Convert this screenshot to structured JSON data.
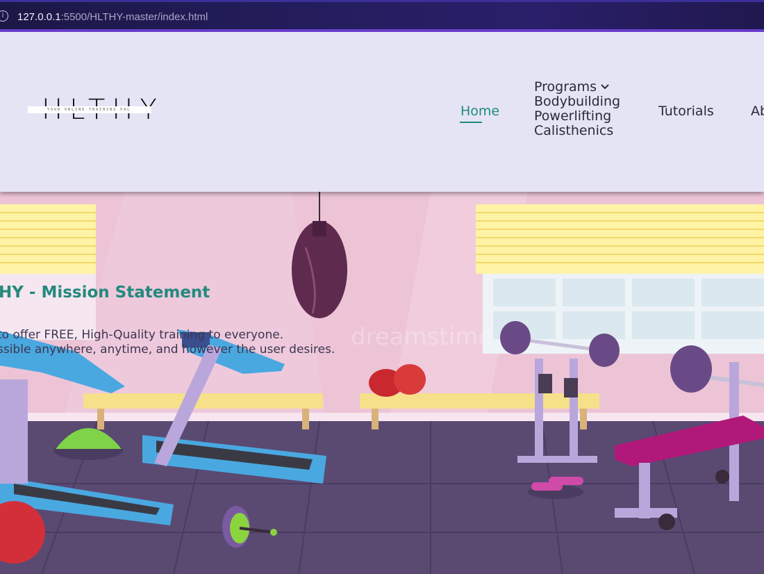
{
  "browser": {
    "url_host": "127.0.0.1",
    "url_rest": ":5500/HLTHY-master/index.html",
    "info_icon": "info-icon"
  },
  "header": {
    "logo_text": "HLTHY",
    "logo_tagline": "YOUR ONLINE TRAINING PAL",
    "nav": {
      "home": "Home",
      "programs": "Programs",
      "programs_items": [
        "Bodybuilding",
        "Powerlifting",
        "Calisthenics"
      ],
      "tutorials": "Tutorials",
      "about": "Ab"
    }
  },
  "hero": {
    "mission_title": "HY - Mission Statement",
    "mission_lines": [
      " to offer FREE, High-Quality training to everyone.",
      "ssible anywhere, anytime, and however the user desires."
    ],
    "watermark": "dreamstime"
  },
  "colors": {
    "accent": "#1f8b7e",
    "header_bg": "#e5e4f5",
    "wall": "#ecc4d6",
    "floor": "#5a4a72"
  }
}
